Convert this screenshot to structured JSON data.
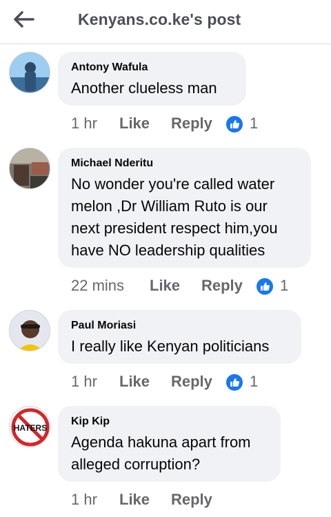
{
  "header": {
    "title": "Kenyans.co.ke's post",
    "back_icon": "arrow-left-icon"
  },
  "colors": {
    "bubble": "#f0f2f5",
    "meta_text": "#65676b",
    "like_blue": "#1877f2"
  },
  "comments": [
    {
      "author": "Antony Wafula",
      "text": "Another clueless man",
      "time": "1 hr",
      "like": "Like",
      "reply": "Reply",
      "reactions": "1"
    },
    {
      "author": "Michael Nderitu",
      "text": "No wonder you're called water\nmelon ,Dr William Ruto is our\nnext president respect him,you\nhave NO leadership qualities",
      "time": "22 mins",
      "like": "Like",
      "reply": "Reply",
      "reactions": "1"
    },
    {
      "author": "Paul Moriasi",
      "text": "I really like Kenyan politicians",
      "time": "1 hr",
      "like": "Like",
      "reply": "Reply",
      "reactions": "1"
    },
    {
      "author": "Kip Kip",
      "text": "Agenda hakuna apart from\nalleged corruption?",
      "time": "1 hr",
      "like": "Like",
      "reply": "Reply"
    }
  ],
  "avatar_badge": "HATERS"
}
